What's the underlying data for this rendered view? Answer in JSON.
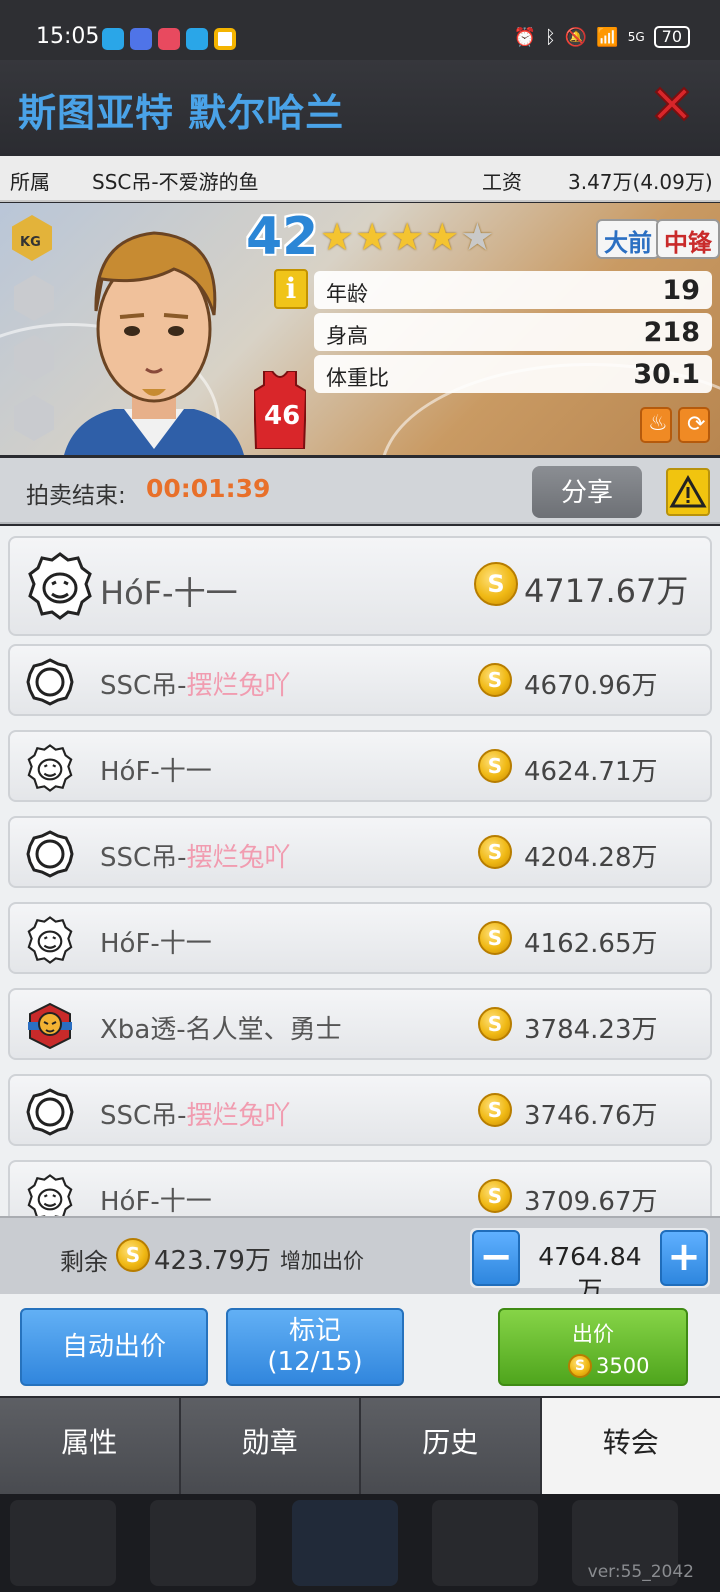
{
  "status_bar": {
    "time": "15:05",
    "network": "5G",
    "battery": "70"
  },
  "player": {
    "name": "斯图亚特 默尔哈兰",
    "team_label": "所属",
    "team": "SSC吊-不爱游的鱼",
    "salary_label": "工资",
    "salary": "3.47万(4.09万)",
    "rating": "42",
    "stars_full": 4,
    "stars_half": 1,
    "badge": "KG",
    "positions": [
      "大前",
      "中锋"
    ],
    "jersey_number": "46",
    "attributes": [
      {
        "label": "年龄",
        "value": "19"
      },
      {
        "label": "身高",
        "value": "218"
      },
      {
        "label": "体重比",
        "value": "30.1"
      }
    ]
  },
  "auction": {
    "end_label": "拍卖结束:",
    "countdown": "00:01:39",
    "share_label": "分享"
  },
  "bids": [
    {
      "team_prefix": "HóF-十一",
      "team_suffix": "",
      "amount": "4717.67万",
      "emblem": "pumpkin-emblem"
    },
    {
      "team_prefix": "SSC吊-",
      "team_suffix": "摆烂兔吖",
      "amount": "4670.96万",
      "emblem": "ring-emblem"
    },
    {
      "team_prefix": "HóF-十一",
      "team_suffix": "",
      "amount": "4624.71万",
      "emblem": "pumpkin-emblem"
    },
    {
      "team_prefix": "SSC吊-",
      "team_suffix": "摆烂兔吖",
      "amount": "4204.28万",
      "emblem": "ring-emblem"
    },
    {
      "team_prefix": "HóF-十一",
      "team_suffix": "",
      "amount": "4162.65万",
      "emblem": "pumpkin-emblem"
    },
    {
      "team_prefix": "Xba透-名人堂、勇士",
      "team_suffix": "",
      "amount": "3784.23万",
      "emblem": "tiger-emblem"
    },
    {
      "team_prefix": "SSC吊-",
      "team_suffix": "摆烂兔吖",
      "amount": "3746.76万",
      "emblem": "ring-emblem"
    },
    {
      "team_prefix": "HóF-十一",
      "team_suffix": "",
      "amount": "3709.67万",
      "emblem": "pumpkin-emblem"
    }
  ],
  "bid_panel": {
    "remaining_label": "剩余",
    "remaining": "423.79万",
    "increase_label": "增加出价",
    "bid_value": "4764.84万",
    "minus": "−",
    "plus": "+"
  },
  "actions": {
    "auto_bid": "自动出价",
    "mark_label": "标记",
    "mark_count": "(12/15)",
    "bid_label": "出价",
    "bid_cost": "3500"
  },
  "tabs": [
    {
      "label": "属性",
      "active": false
    },
    {
      "label": "勋章",
      "active": false
    },
    {
      "label": "历史",
      "active": false
    },
    {
      "label": "转会",
      "active": true
    }
  ],
  "version": "ver:55_2042",
  "colors": {
    "title_blue": "#4aa3e8",
    "countdown_orange": "#e8702a",
    "highlight_pink": "#f19cb0",
    "bid_green": "#4fa51d"
  }
}
